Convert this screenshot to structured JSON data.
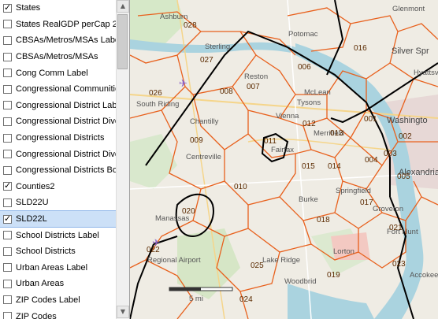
{
  "layers": [
    {
      "label": "States",
      "checked": true,
      "selected": false
    },
    {
      "label": "States RealGDP perCap 20",
      "checked": false,
      "selected": false
    },
    {
      "label": "CBSAs/Metros/MSAs Labe",
      "checked": false,
      "selected": false
    },
    {
      "label": "CBSAs/Metros/MSAs",
      "checked": false,
      "selected": false
    },
    {
      "label": "Cong Comm Label",
      "checked": false,
      "selected": false
    },
    {
      "label": "Congressional Communitie",
      "checked": false,
      "selected": false
    },
    {
      "label": "Congressional District Lab",
      "checked": false,
      "selected": false
    },
    {
      "label": "Congressional District Dive",
      "checked": false,
      "selected": false
    },
    {
      "label": "Congressional Districts",
      "checked": false,
      "selected": false
    },
    {
      "label": "Congressional District Dive",
      "checked": false,
      "selected": false
    },
    {
      "label": "Congressional Districts Bo",
      "checked": false,
      "selected": false
    },
    {
      "label": "Counties2",
      "checked": true,
      "selected": false
    },
    {
      "label": "SLD22U",
      "checked": false,
      "selected": false
    },
    {
      "label": "SLD22L",
      "checked": true,
      "selected": true
    },
    {
      "label": "School Districts Label",
      "checked": false,
      "selected": false
    },
    {
      "label": "School Districts",
      "checked": false,
      "selected": false
    },
    {
      "label": "Urban Areas Label",
      "checked": false,
      "selected": false
    },
    {
      "label": "Urban Areas",
      "checked": false,
      "selected": false
    },
    {
      "label": "ZIP Codes Label",
      "checked": false,
      "selected": false
    },
    {
      "label": "ZIP Codes",
      "checked": false,
      "selected": false
    }
  ],
  "map": {
    "district_labels": [
      "028",
      "027",
      "026",
      "008",
      "007",
      "006",
      "016",
      "001",
      "012",
      "013",
      "002",
      "003",
      "004",
      "005",
      "009",
      "011",
      "014",
      "015",
      "010",
      "017",
      "018",
      "020",
      "021",
      "022",
      "025",
      "024",
      "019",
      "023"
    ],
    "place_names": {
      "ashburn": "Ashburn",
      "sterling": "Sterling",
      "reston": "Reston",
      "south_riding": "South Riding",
      "chantilly": "Chantilly",
      "centreville": "Centreville",
      "mclean": "McLean",
      "potomac": "Potomac",
      "silver_spring": "Silver Spr",
      "glenmont": "Glenmont",
      "washington": "Washingto",
      "alexandria": "Alexandria",
      "vienna": "Vienna",
      "tysons": "Tysons",
      "merrifield": "Merrifield",
      "fairfax": "Fairfax",
      "burke": "Burke",
      "springfield": "Springfield",
      "groveton": "Groveton",
      "fort_hunt": "Fort Hunt",
      "manassas": "Manassas",
      "regional_airport": "Regional\nAirport",
      "lake_ridge": "Lake Ridge",
      "woodbridge": "Woodbrid",
      "lorton": "Lorton",
      "accokeek": "Accokeek",
      "hyattsville": "Hyattsv"
    },
    "scale_label": "5 mi"
  },
  "colors": {
    "district_line": "#e8601c",
    "county_line": "#000000",
    "selection": "#cce0f7"
  }
}
